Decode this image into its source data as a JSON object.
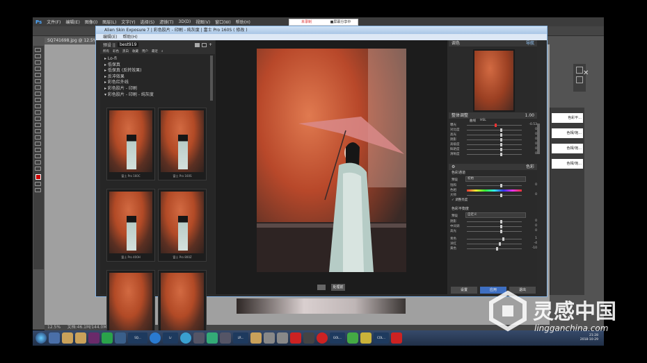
{
  "ps": {
    "logo": "Ps",
    "menu": [
      "文件(F)",
      "编辑(E)",
      "图像(I)",
      "图层(L)",
      "文字(Y)",
      "选择(S)",
      "滤镜(T)",
      "3D(D)",
      "视图(V)",
      "窗口(W)",
      "帮助(H)"
    ],
    "doc_tab": "SQ741698.jpg @ 12.5%(图...",
    "status_zoom": "12.5%",
    "status_doc": "文档:46.1M/144.0M"
  },
  "topbar": {
    "left": "未录制",
    "right": "■屏幕分享中"
  },
  "plugin": {
    "title": "Alien Skin Exposure 7 | 彩色胶片 - 印刷 - 纯灰度 | 富士 Pro 160S ( 修改 )",
    "menu": [
      "编辑(E)",
      "帮助(H)"
    ],
    "preset_label": "预设 ||",
    "search_value": "best919",
    "filter_tabs": [
      "所有",
      "彩色",
      "黑白",
      "收藏",
      "用户",
      "最近"
    ],
    "tree": [
      "Lo-fi",
      "低保真",
      "低保真 (反转效果)",
      "反冲效果",
      "彩色红外线",
      "彩色胶片 - 印刷",
      "彩色胶片 - 印刷 - 纯灰度"
    ],
    "thumbs": [
      "富士 Pro 160C",
      "富士 Pro 160S",
      "富士 Pro 400H",
      "富士 Pro 800Z",
      "",
      ""
    ],
    "compare_btn": "处理前",
    "panel": {
      "header_left": "调色",
      "header_right": "导航",
      "section1_left": "整体调整",
      "section1_val": "1.00",
      "sec1_tabs": [
        "曲线",
        "HSL"
      ],
      "sliders1": [
        {
          "label": "曝光",
          "value": "-0.53"
        },
        {
          "label": "对比度",
          "value": "0"
        },
        {
          "label": "高光",
          "value": "0"
        },
        {
          "label": "阴影",
          "value": "0"
        },
        {
          "label": "高级度",
          "value": "0"
        },
        {
          "label": "鲜艳度",
          "value": "0"
        },
        {
          "label": "清晰度",
          "value": "0"
        }
      ],
      "section2_right": "色彩",
      "section2_title": "色彩通道",
      "preset_label": "预设",
      "preset_value": "初始",
      "sliders2": [
        {
          "label": "饱和",
          "value": "0"
        },
        {
          "label": "色相",
          "value": ""
        },
        {
          "label": "大师",
          "value": "0"
        }
      ],
      "checkbox": "调整亮度",
      "section3_title": "色彩平衡度",
      "preset3_value": "自定义",
      "sliders3": [
        {
          "label": "阴影",
          "value": "0"
        },
        {
          "label": "中间调",
          "value": "0"
        },
        {
          "label": "高光",
          "value": "0"
        },
        {
          "label": "青色",
          "value": "1"
        },
        {
          "label": "洋红",
          "value": "-4"
        },
        {
          "label": "黄色",
          "value": "-10"
        }
      ],
      "buttons": [
        "设置",
        "应用",
        "退出"
      ]
    }
  },
  "right_panel_items": [
    "色彩平...",
    "色相/饱...",
    "色相/饱...",
    "色相/饱..."
  ],
  "taskbar": {
    "time": "21:28",
    "date": "2018-10-29",
    "windows": [
      "SQ...",
      "Lr",
      "LR...",
      "GOL...",
      "COL..."
    ]
  },
  "watermark": {
    "brand": "灵感中国",
    "url": "lingganchina.com"
  }
}
